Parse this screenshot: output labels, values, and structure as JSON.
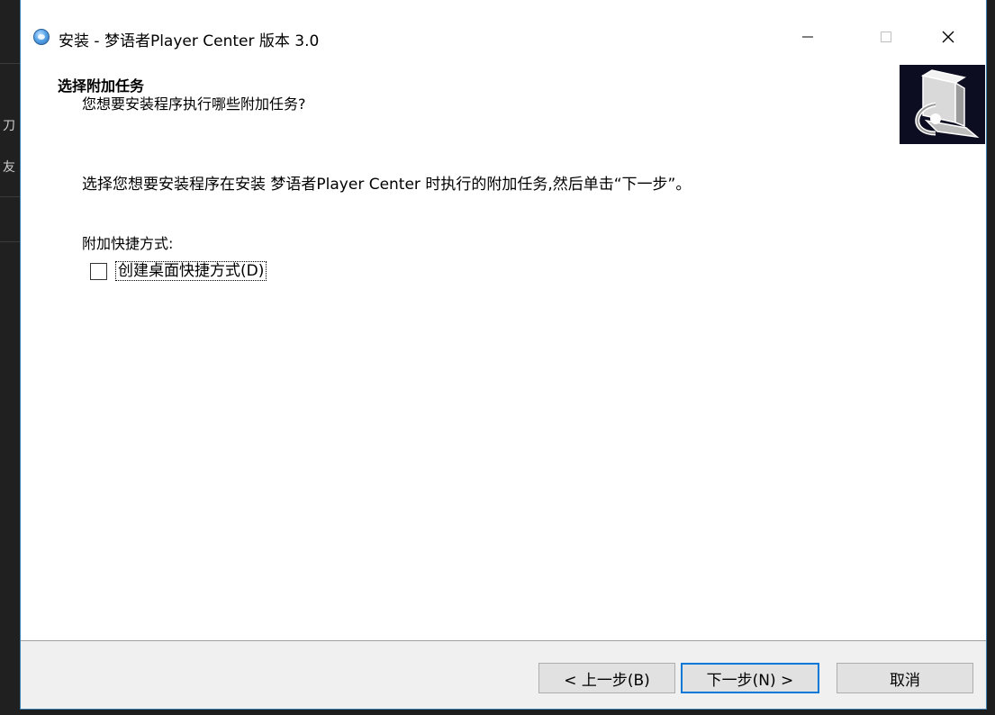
{
  "window": {
    "title": "安装 - 梦语者Player Center 版本 3.0",
    "accent_color": "#0078d7",
    "controls": {
      "minimize_icon": "minimize-icon",
      "maximize_icon": "maximize-icon",
      "close_icon": "close-icon"
    }
  },
  "header": {
    "title": "选择附加任务",
    "subtitle": "您想要安装程序执行哪些附加任务?"
  },
  "body": {
    "description": "选择您想要安装程序在安装 梦语者Player Center 时执行的附加任务,然后单击“下一步”。",
    "group_label": "附加快捷方式:",
    "tasks": [
      {
        "label": "创建桌面快捷方式(D)",
        "checked": false
      }
    ]
  },
  "buttons": {
    "back": "< 上一步(B)",
    "next": "下一步(N) >",
    "cancel": "取消"
  },
  "background_glyphs": [
    "刀",
    "友"
  ]
}
